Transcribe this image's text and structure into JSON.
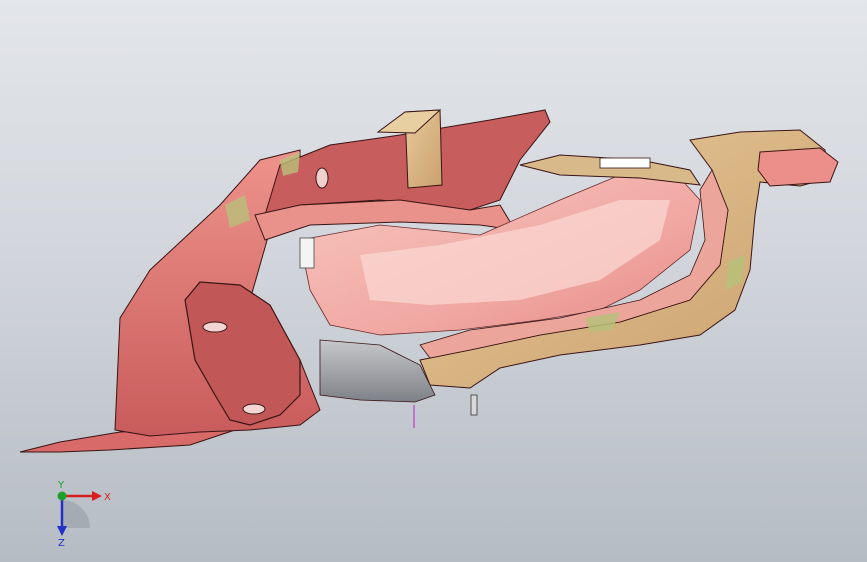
{
  "viewport": {
    "background_top": "#e3e6ea",
    "background_bottom": "#b6bcc4"
  },
  "model": {
    "part_color": "#e07c78",
    "part_shadow": "#a8474a",
    "part_highlight": "#f6b8b0",
    "tan_color": "#d7b98a",
    "green_tint": "#b8c07a",
    "edge_color": "#3a1414"
  },
  "triad": {
    "x_label": "X",
    "y_label": "Y",
    "z_label": "Z",
    "x_color": "#d42020",
    "y_color": "#1fa02a",
    "z_color": "#2030c8"
  }
}
